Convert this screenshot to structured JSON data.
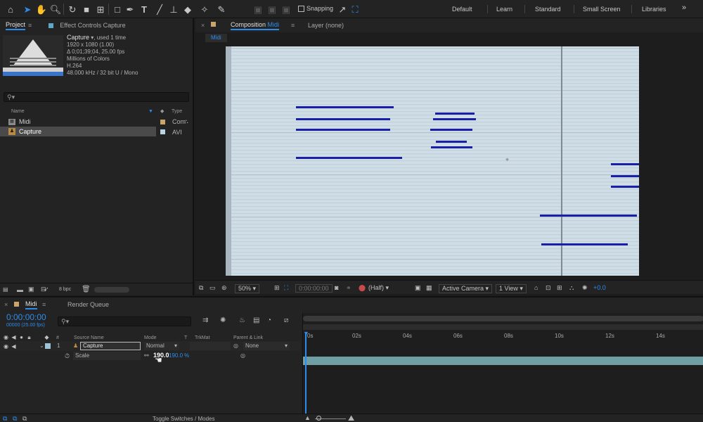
{
  "toolbar": {
    "snapping_label": "Snapping",
    "workspaces": [
      "Default",
      "Learn",
      "Standard",
      "Small Screen",
      "Libraries"
    ]
  },
  "project_panel": {
    "tab_project": "Project",
    "tab_effect_controls": "Effect Controls Capture",
    "footage": {
      "name": "Capture",
      "used": ", used 1 time",
      "resolution": "1920 x 1080 (1.00)",
      "duration": "Δ 0;01;39;04, 25.00 fps",
      "colors": "Millions of Colors",
      "codec": "H.264",
      "audio": "48.000 kHz / 32 bit U / Mono"
    },
    "search_placeholder": "",
    "col_name": "Name",
    "col_type": "Type",
    "items": [
      {
        "name": "Midi",
        "type": "Com"
      },
      {
        "name": "Capture",
        "type": "AVI"
      }
    ],
    "bpc": "8 bpc"
  },
  "comp_viewer": {
    "tab_prefix": "Composition",
    "tab_comp": "Midi",
    "tab_layer": "Layer (none)",
    "breadcrumb": "Midi",
    "zoom": "50%",
    "timecode": "0:00:00:00",
    "resolution": "(Half)",
    "camera": "Active Camera",
    "view": "1 View",
    "exposure": "+0.0"
  },
  "timeline": {
    "tab_comp": "Midi",
    "tab_render": "Render Queue",
    "timecode": "0:00:00:00",
    "frame_info": "00000 (25.00 fps)",
    "col_hash": "#",
    "col_source": "Source Name",
    "col_mode": "Mode",
    "col_t": "T",
    "col_trkmat": "TrkMat",
    "col_parent": "Parent & Link",
    "layer": {
      "number": "1",
      "name": "Capture",
      "mode": "Normal",
      "parent": "None"
    },
    "property": {
      "name": "Scale",
      "value_x": "190.0",
      "value_y": "190.0",
      "unit": "%"
    },
    "ruler": [
      "0s",
      "02s",
      "04s",
      "06s",
      "08s",
      "10s",
      "12s",
      "14s"
    ],
    "toggle_label": "Toggle Switches / Modes"
  },
  "colors": {
    "accent": "#2d8ceb",
    "note": "#1a1fa8",
    "canvas": "#cfdde6",
    "layer_bar": "#6f9ea5"
  }
}
